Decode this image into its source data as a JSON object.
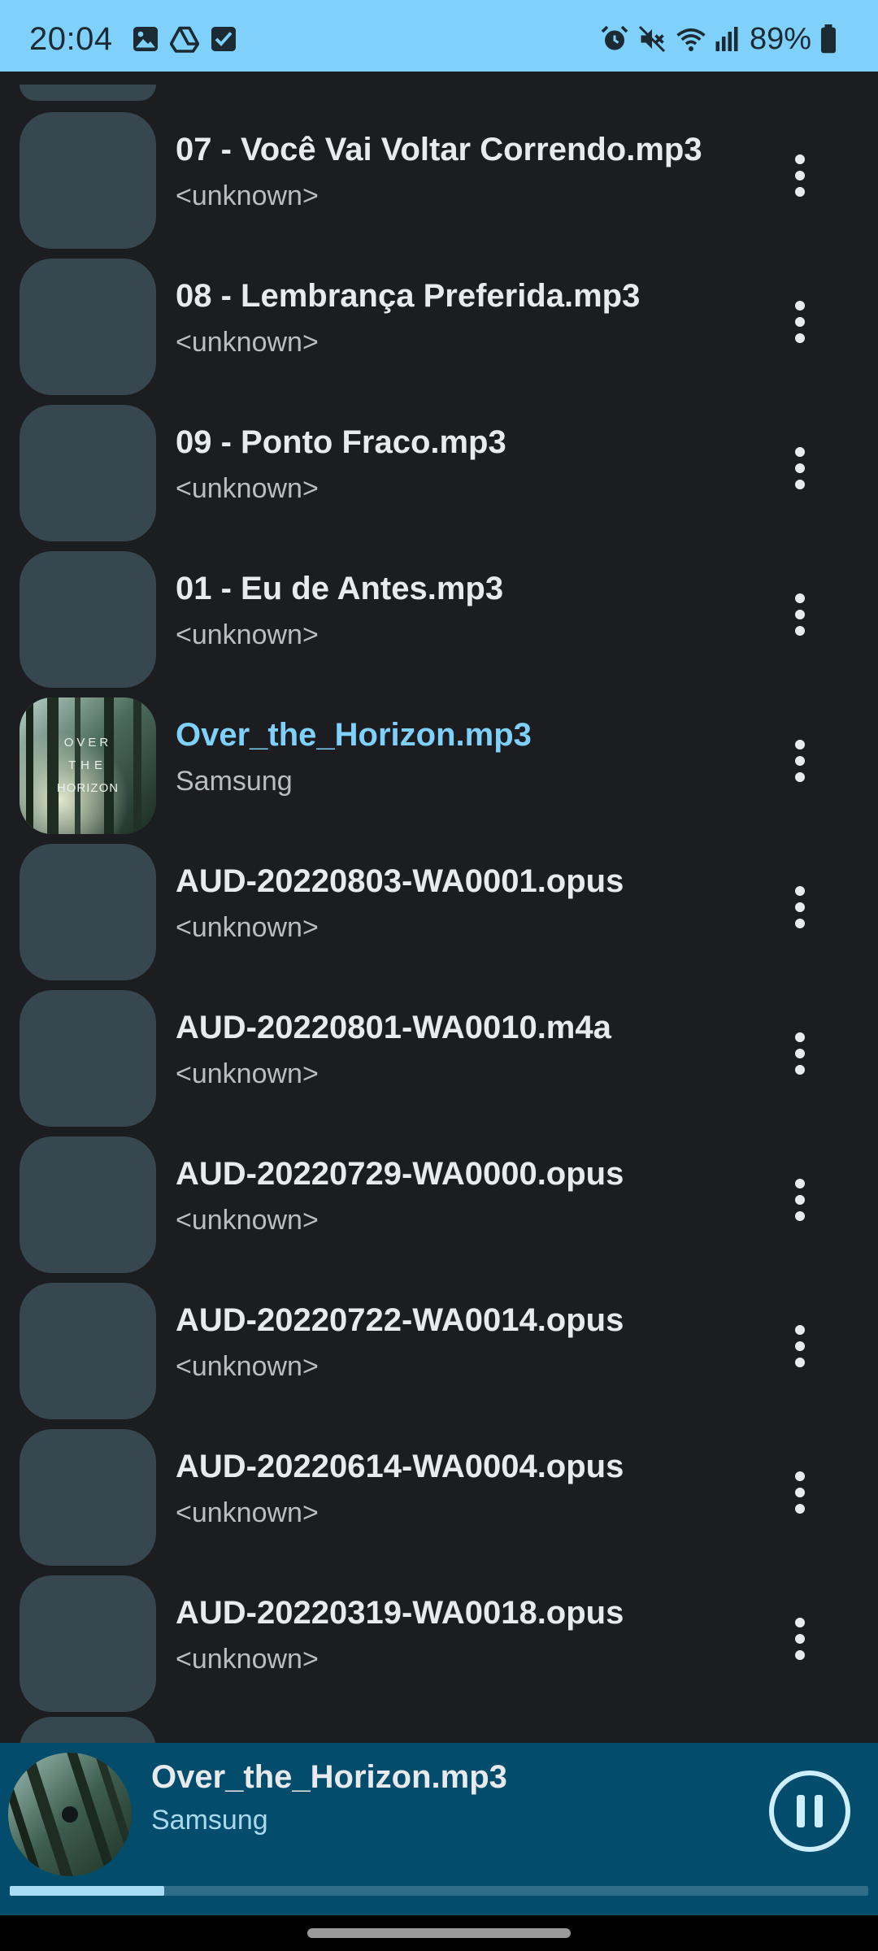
{
  "status_bar": {
    "time": "20:04",
    "battery": "89%",
    "left_icons": [
      "gallery-icon",
      "drive-icon",
      "checkbox-icon"
    ],
    "right_icons": [
      "alarm-icon",
      "mute-icon",
      "wifi-icon",
      "signal-icon",
      "battery-icon"
    ],
    "background": "#7fd0fb"
  },
  "songs": [
    {
      "title": "07 - Você Vai Voltar Correndo.mp3",
      "artist": "<unknown>"
    },
    {
      "title": "08 - Lembrança Preferida.mp3",
      "artist": "<unknown>"
    },
    {
      "title": "09 - Ponto Fraco.mp3",
      "artist": "<unknown>"
    },
    {
      "title": "01 - Eu de Antes.mp3",
      "artist": "<unknown>"
    },
    {
      "title": "Over_the_Horizon.mp3",
      "artist": "Samsung"
    },
    {
      "title": "AUD-20220803-WA0001.opus",
      "artist": "<unknown>"
    },
    {
      "title": "AUD-20220801-WA0010.m4a",
      "artist": "<unknown>"
    },
    {
      "title": "AUD-20220729-WA0000.opus",
      "artist": "<unknown>"
    },
    {
      "title": "AUD-20220722-WA0014.opus",
      "artist": "<unknown>"
    },
    {
      "title": "AUD-20220614-WA0004.opus",
      "artist": "<unknown>"
    },
    {
      "title": "AUD-20220319-WA0018.opus",
      "artist": "<unknown>"
    }
  ],
  "album_art_text": {
    "line1": "OVER",
    "line2": "THE",
    "line3": "HORIZON"
  },
  "now_playing": {
    "title": "Over_the_Horizon.mp3",
    "artist": "Samsung",
    "progress": 0.18,
    "state_icon": "pause-icon"
  },
  "colors": {
    "accent": "#7fd0fb",
    "background": "#1b1d20",
    "placeholder_art": "#37474f",
    "player_bar": "#034c6c"
  }
}
